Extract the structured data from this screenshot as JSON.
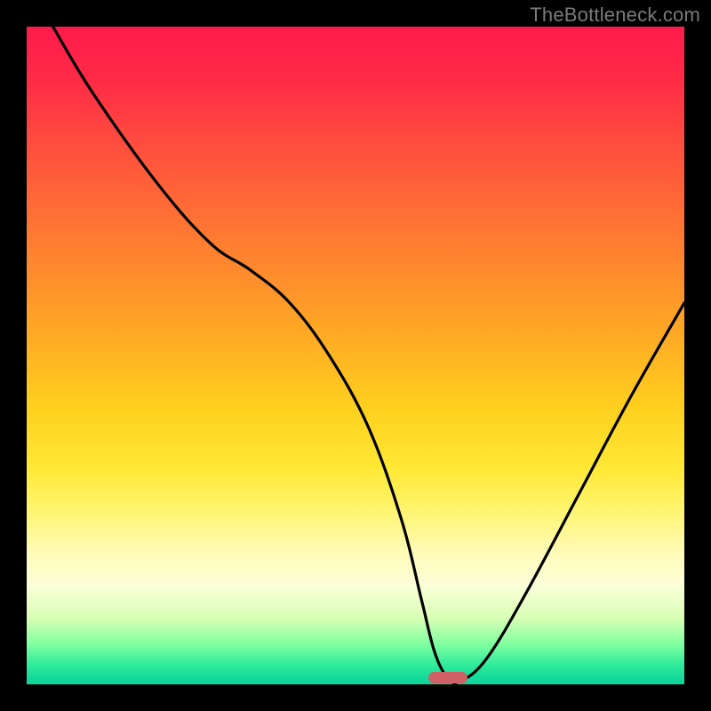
{
  "watermark": "TheBottleneck.com",
  "chart_data": {
    "type": "line",
    "title": "",
    "xlabel": "",
    "ylabel": "",
    "xlim": [
      0,
      100
    ],
    "ylim": [
      0,
      100
    ],
    "grid": false,
    "series": [
      {
        "name": "bottleneck-curve",
        "x": [
          4,
          10,
          20,
          28,
          34,
          40,
          46,
          52,
          57,
          60,
          62,
          64,
          66,
          70,
          76,
          84,
          92,
          100
        ],
        "values": [
          100,
          90,
          76,
          67,
          63,
          58,
          50,
          39,
          25,
          13,
          5,
          1,
          0.5,
          4,
          14,
          29,
          44,
          58
        ]
      }
    ],
    "marker": {
      "x": 64,
      "y": 0.5
    },
    "background_gradient": {
      "stops": [
        {
          "pos": 0,
          "color": "#ff1b4b"
        },
        {
          "pos": 50,
          "color": "#ffd01e"
        },
        {
          "pos": 85,
          "color": "#fcffd9"
        },
        {
          "pos": 100,
          "color": "#0fd49b"
        }
      ]
    }
  }
}
